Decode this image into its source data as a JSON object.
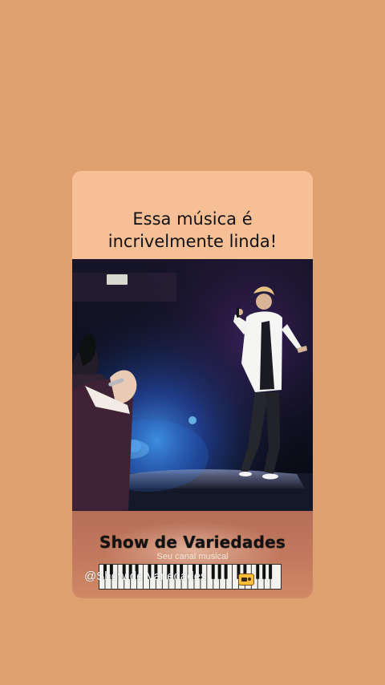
{
  "header": {
    "headline_line1": "Essa música é",
    "headline_line2": "incrivelmente linda!"
  },
  "video": {
    "sign_text": "",
    "scene": "concert"
  },
  "footer": {
    "show_title": "Show de Variedades",
    "subtitle": "Seu canal musical",
    "handle": "@Show de Variedades",
    "icon": "radio-icon"
  }
}
